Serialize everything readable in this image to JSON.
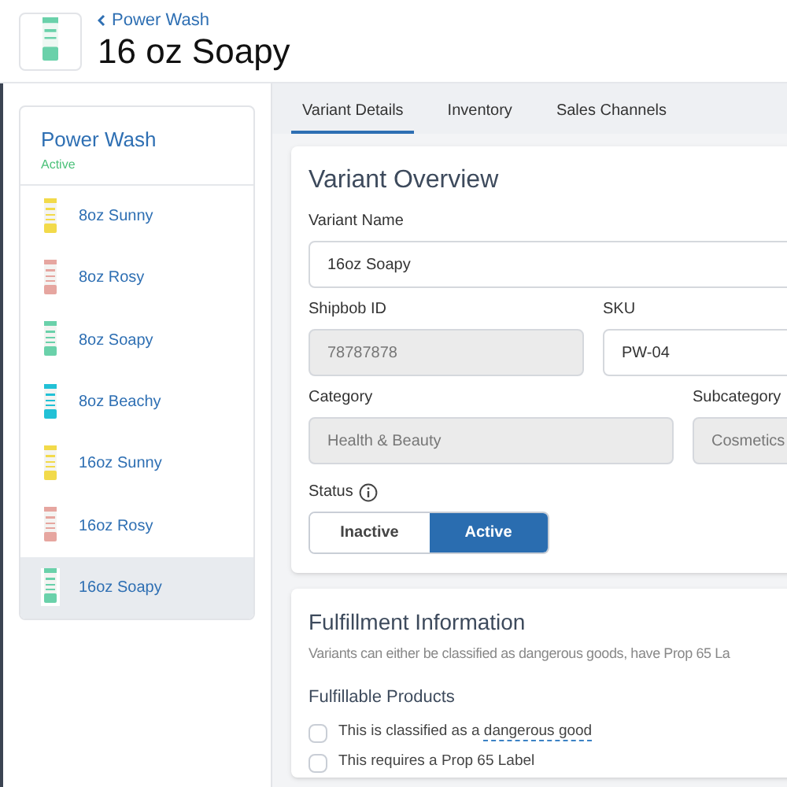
{
  "header": {
    "back_link": "Power Wash",
    "title": "16 oz Soapy"
  },
  "sidebar": {
    "title": "Power Wash",
    "status": "Active",
    "items": [
      {
        "label": "8oz Sunny",
        "color": "#f2da4a",
        "selected": false
      },
      {
        "label": "8oz Rosy",
        "color": "#e6a6a0",
        "selected": false
      },
      {
        "label": "8oz Soapy",
        "color": "#6ad1aa",
        "selected": false
      },
      {
        "label": "8oz Beachy",
        "color": "#22c1d6",
        "selected": false
      },
      {
        "label": "16oz Sunny",
        "color": "#f2da4a",
        "selected": false
      },
      {
        "label": "16oz Rosy",
        "color": "#e6a6a0",
        "selected": false
      },
      {
        "label": "16oz Soapy",
        "color": "#6ad1aa",
        "selected": true
      }
    ]
  },
  "tabs": [
    {
      "label": "Variant Details",
      "selected": true
    },
    {
      "label": "Inventory",
      "selected": false
    },
    {
      "label": "Sales Channels",
      "selected": false
    }
  ],
  "overview": {
    "title": "Variant Overview",
    "rows": [
      [
        {
          "label": "Variant Name",
          "value": "16oz Soapy",
          "disabled": false
        }
      ],
      [
        {
          "label": "Shipbob ID",
          "value": "78787878",
          "disabled": true
        },
        {
          "label": "SKU",
          "value": "PW-04",
          "disabled": false
        }
      ],
      [
        {
          "label": "Category",
          "value": "Health & Beauty",
          "disabled": true
        },
        {
          "label": "Subcategory",
          "value": "Cosmetics",
          "disabled": true
        }
      ]
    ],
    "status": {
      "label": "Status",
      "options": [
        {
          "label": "Inactive",
          "selected": false
        },
        {
          "label": "Active",
          "selected": true
        }
      ]
    }
  },
  "fulfillment": {
    "title": "Fulfillment Information",
    "description": "Variants can either be classified as dangerous goods, have Prop 65 La",
    "subtitle": "Fulfillable Products",
    "checkboxes": [
      {
        "text": "This is classified as a ",
        "term": "dangerous good",
        "checked": false
      },
      {
        "text": "This requires a Prop 65 Label",
        "checked": false
      }
    ]
  }
}
